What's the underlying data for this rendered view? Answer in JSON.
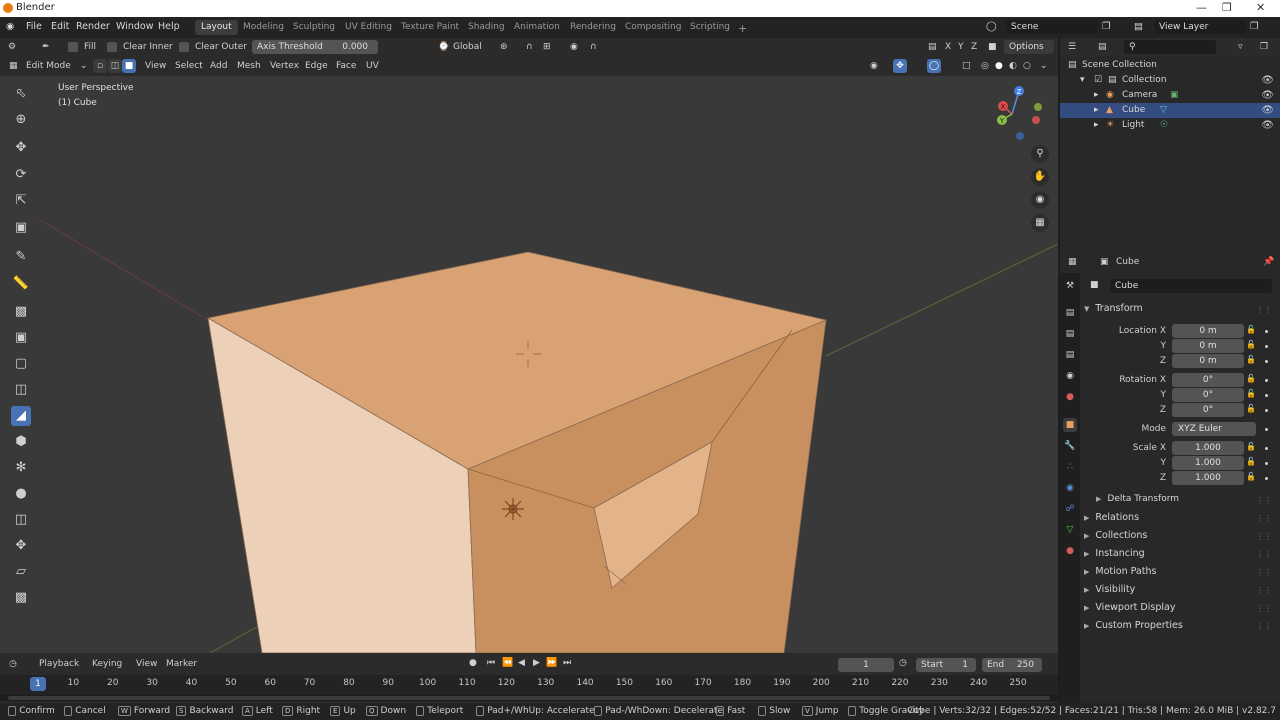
{
  "app": {
    "title": "Blender"
  },
  "menu": [
    "File",
    "Edit",
    "Render",
    "Window",
    "Help"
  ],
  "workspaces": [
    "Layout",
    "Modeling",
    "Sculpting",
    "UV Editing",
    "Texture Paint",
    "Shading",
    "Animation",
    "Rendering",
    "Compositing",
    "Scripting"
  ],
  "active_workspace": "Layout",
  "scene": {
    "label": "Scene",
    "view_layer": "View Layer"
  },
  "tool_header": {
    "fill_label": "Fill",
    "clear_inner_label": "Clear Inner",
    "clear_outer_label": "Clear Outer",
    "axis_threshold_label": "Axis Threshold",
    "axis_threshold_value": "0.000",
    "orientation": "Global",
    "axes": [
      "X",
      "Y",
      "Z"
    ],
    "options_label": "Options"
  },
  "mode_header": {
    "mode": "Edit Mode",
    "menus": [
      "View",
      "Select",
      "Add",
      "Mesh",
      "Vertex",
      "Edge",
      "Face",
      "UV"
    ]
  },
  "viewport": {
    "perspective_label": "User Perspective",
    "object_label": "(1) Cube",
    "gizmo_labels": {
      "x": "X",
      "y": "Y",
      "z": "Z"
    }
  },
  "outliner": {
    "root": "Scene Collection",
    "items": [
      {
        "label": "Collection",
        "indent": 1
      },
      {
        "label": "Camera",
        "indent": 2
      },
      {
        "label": "Cube",
        "indent": 2,
        "selected": true
      },
      {
        "label": "Light",
        "indent": 2
      }
    ]
  },
  "properties": {
    "object_name": "Cube",
    "data_name": "Cube",
    "transform_title": "Transform",
    "location": {
      "label": "Location X",
      "x": "0 m",
      "y": "0 m",
      "z": "0 m"
    },
    "rotation": {
      "label": "Rotation X",
      "x": "0°",
      "y": "0°",
      "z": "0°"
    },
    "mode": {
      "label": "Mode",
      "value": "XYZ Euler"
    },
    "scale": {
      "label": "Scale X",
      "x": "1.000",
      "y": "1.000",
      "z": "1.000"
    },
    "axis_y": "Y",
    "axis_z": "Z",
    "delta_transform": "Delta Transform",
    "panels": [
      "Relations",
      "Collections",
      "Instancing",
      "Motion Paths",
      "Visibility",
      "Viewport Display",
      "Custom Properties"
    ]
  },
  "timeline": {
    "menus": [
      "Playback",
      "Keying",
      "View",
      "Marker"
    ],
    "current_frame": "1",
    "start_label": "Start",
    "start": "1",
    "end_label": "End",
    "end": "250",
    "ticks": [
      "1",
      "10",
      "20",
      "30",
      "40",
      "50",
      "60",
      "70",
      "80",
      "90",
      "100",
      "110",
      "120",
      "130",
      "140",
      "150",
      "160",
      "170",
      "180",
      "190",
      "200",
      "210",
      "220",
      "230",
      "240",
      "250"
    ]
  },
  "statusbar": {
    "hints": [
      {
        "key": "",
        "label": "Confirm"
      },
      {
        "key": "",
        "label": "Cancel"
      },
      {
        "key": "W",
        "label": "Forward"
      },
      {
        "key": "S",
        "label": "Backward"
      },
      {
        "key": "A",
        "label": "Left"
      },
      {
        "key": "D",
        "label": "Right"
      },
      {
        "key": "E",
        "label": "Up"
      },
      {
        "key": "Q",
        "label": "Down"
      },
      {
        "key": "",
        "label": "Teleport"
      },
      {
        "key": "",
        "label": "Pad+/WhUp: Accelerate"
      },
      {
        "key": "",
        "label": "Pad-/WhDown: Decelerate"
      },
      {
        "key": "",
        "label": "Fast"
      },
      {
        "key": "",
        "label": "Slow"
      },
      {
        "key": "V",
        "label": "Jump"
      },
      {
        "key": "",
        "label": "Toggle Gravity"
      }
    ],
    "stats": "Cube | Verts:32/32 | Edges:52/52 | Faces:21/21 | Tris:58 | Mem: 26.0 MiB | v2.82.7"
  },
  "colors": {
    "accent": "#4772b3",
    "selection": "#334d80",
    "cube_top": "#d8a274",
    "cube_left": "#ecd1b8",
    "cube_front": "#c8905e"
  }
}
